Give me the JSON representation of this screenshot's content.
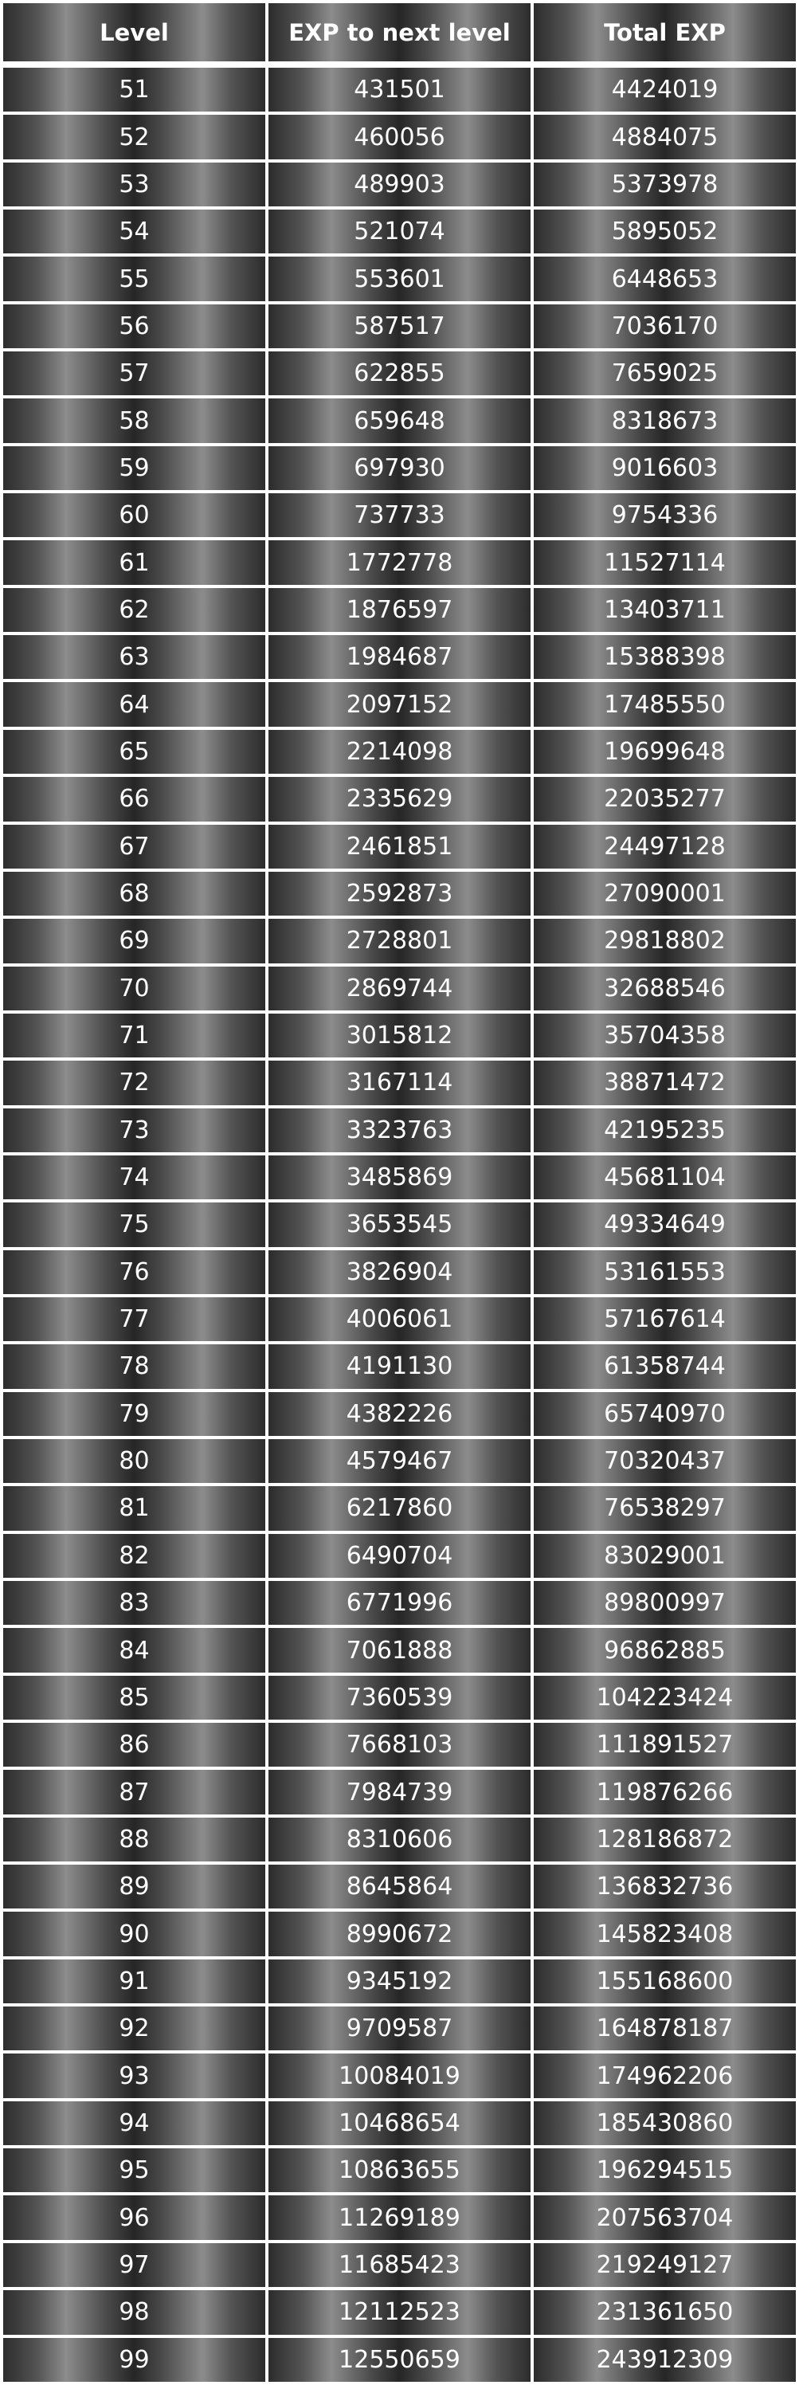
{
  "table": {
    "headers": [
      "Level",
      "EXP to next level",
      "Total EXP"
    ],
    "rows": [
      [
        "51",
        "431501",
        "4424019"
      ],
      [
        "52",
        "460056",
        "4884075"
      ],
      [
        "53",
        "489903",
        "5373978"
      ],
      [
        "54",
        "521074",
        "5895052"
      ],
      [
        "55",
        "553601",
        "6448653"
      ],
      [
        "56",
        "587517",
        "7036170"
      ],
      [
        "57",
        "622855",
        "7659025"
      ],
      [
        "58",
        "659648",
        "8318673"
      ],
      [
        "59",
        "697930",
        "9016603"
      ],
      [
        "60",
        "737733",
        "9754336"
      ],
      [
        "61",
        "1772778",
        "11527114"
      ],
      [
        "62",
        "1876597",
        "13403711"
      ],
      [
        "63",
        "1984687",
        "15388398"
      ],
      [
        "64",
        "2097152",
        "17485550"
      ],
      [
        "65",
        "2214098",
        "19699648"
      ],
      [
        "66",
        "2335629",
        "22035277"
      ],
      [
        "67",
        "2461851",
        "24497128"
      ],
      [
        "68",
        "2592873",
        "27090001"
      ],
      [
        "69",
        "2728801",
        "29818802"
      ],
      [
        "70",
        "2869744",
        "32688546"
      ],
      [
        "71",
        "3015812",
        "35704358"
      ],
      [
        "72",
        "3167114",
        "38871472"
      ],
      [
        "73",
        "3323763",
        "42195235"
      ],
      [
        "74",
        "3485869",
        "45681104"
      ],
      [
        "75",
        "3653545",
        "49334649"
      ],
      [
        "76",
        "3826904",
        "53161553"
      ],
      [
        "77",
        "4006061",
        "57167614"
      ],
      [
        "78",
        "4191130",
        "61358744"
      ],
      [
        "79",
        "4382226",
        "65740970"
      ],
      [
        "80",
        "4579467",
        "70320437"
      ],
      [
        "81",
        "6217860",
        "76538297"
      ],
      [
        "82",
        "6490704",
        "83029001"
      ],
      [
        "83",
        "6771996",
        "89800997"
      ],
      [
        "84",
        "7061888",
        "96862885"
      ],
      [
        "85",
        "7360539",
        "104223424"
      ],
      [
        "86",
        "7668103",
        "111891527"
      ],
      [
        "87",
        "7984739",
        "119876266"
      ],
      [
        "88",
        "8310606",
        "128186872"
      ],
      [
        "89",
        "8645864",
        "136832736"
      ],
      [
        "90",
        "8990672",
        "145823408"
      ],
      [
        "91",
        "9345192",
        "155168600"
      ],
      [
        "92",
        "9709587",
        "164878187"
      ],
      [
        "93",
        "10084019",
        "174962206"
      ],
      [
        "94",
        "10468654",
        "185430860"
      ],
      [
        "95",
        "10863655",
        "196294515"
      ],
      [
        "96",
        "11269189",
        "207563704"
      ],
      [
        "97",
        "11685423",
        "219249127"
      ],
      [
        "98",
        "12112523",
        "231361650"
      ],
      [
        "99",
        "12550659",
        "243912309"
      ]
    ]
  }
}
